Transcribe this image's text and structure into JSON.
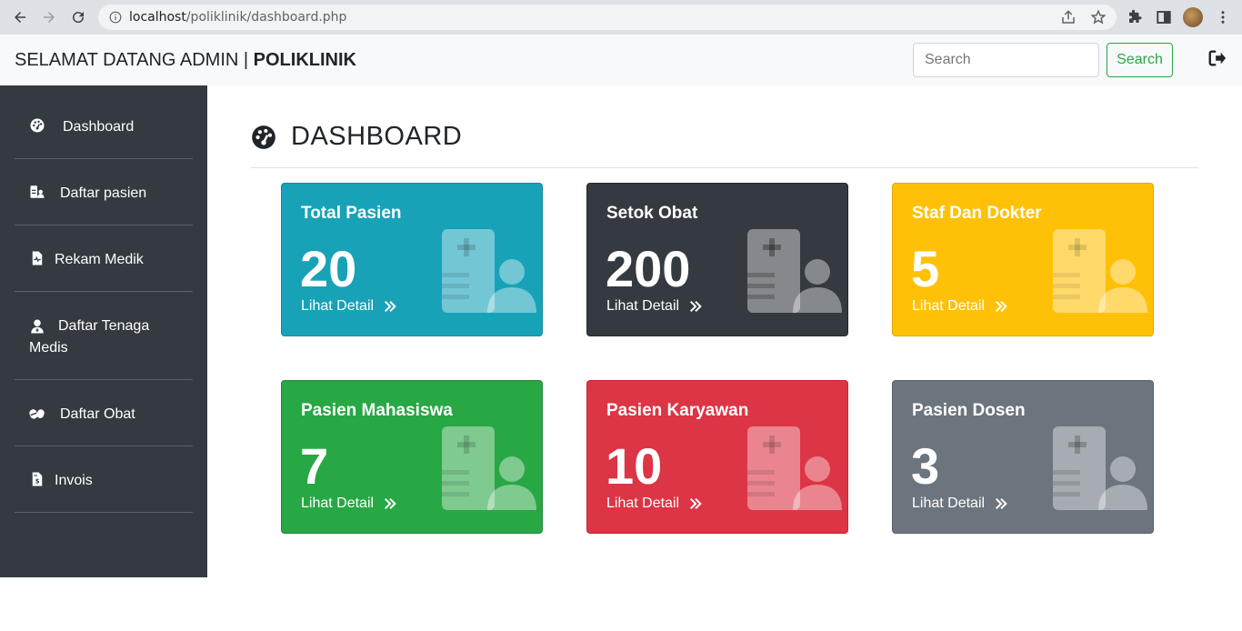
{
  "browser": {
    "url_host": "localhost",
    "url_path": "/poliklinik/dashboard.php"
  },
  "navbar": {
    "brand_prefix": "SELAMAT DATANG ADMIN | ",
    "brand_name": "POLIKLINIK",
    "search_placeholder": "Search",
    "search_button": "Search"
  },
  "sidebar": {
    "items": [
      {
        "label": "Dashboard",
        "icon": "tachometer-icon"
      },
      {
        "label": "Daftar pasien",
        "icon": "user-list-icon"
      },
      {
        "label": "Rekam Medik",
        "icon": "file-medical-icon"
      },
      {
        "label": "Daftar Tenaga Medis",
        "icon": "user-md-icon"
      },
      {
        "label": "Daftar Obat",
        "icon": "capsules-icon"
      },
      {
        "label": "Invois",
        "icon": "invoice-icon"
      }
    ]
  },
  "main": {
    "title": "DASHBOARD",
    "cards": [
      {
        "title": "Total Pasien",
        "value": "20",
        "link": "Lihat Detail",
        "color": "#17a2b8"
      },
      {
        "title": "Setok Obat",
        "value": "200",
        "link": "Lihat Detail",
        "color": "#343a40"
      },
      {
        "title": "Staf Dan Dokter",
        "value": "5",
        "link": "Lihat Detail",
        "color": "#ffc107"
      },
      {
        "title": "Pasien Mahasiswa",
        "value": "7",
        "link": "Lihat Detail",
        "color": "#28a745"
      },
      {
        "title": "Pasien Karyawan",
        "value": "10",
        "link": "Lihat Detail",
        "color": "#dc3545"
      },
      {
        "title": "Pasien Dosen",
        "value": "3",
        "link": "Lihat Detail",
        "color": "#6c757d"
      }
    ]
  }
}
